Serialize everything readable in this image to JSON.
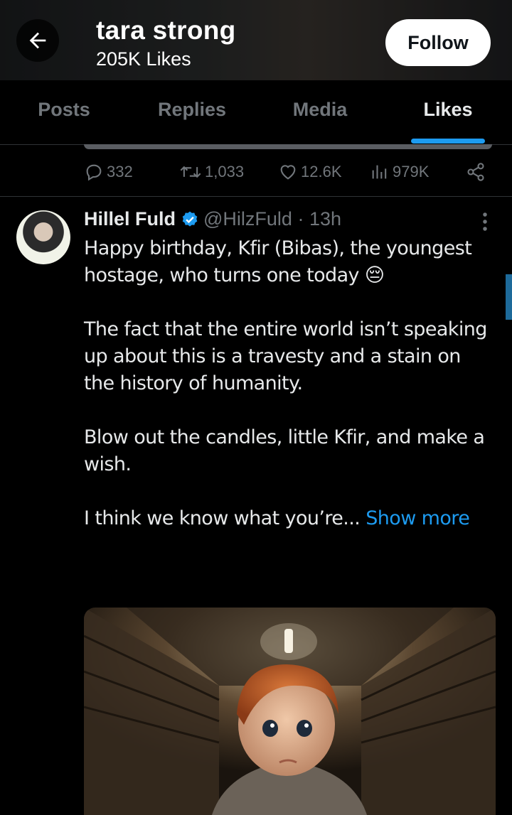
{
  "header": {
    "title": "tara strong",
    "subtitle": "205K Likes",
    "follow_label": "Follow"
  },
  "tabs": [
    {
      "label": "Posts",
      "active": false
    },
    {
      "label": "Replies",
      "active": false
    },
    {
      "label": "Media",
      "active": false
    },
    {
      "label": "Likes",
      "active": true
    }
  ],
  "prev_post_actions": {
    "replies": "332",
    "reposts": "1,033",
    "likes": "12.6K",
    "views": "979K",
    "icons": [
      "reply-icon",
      "repost-icon",
      "like-icon",
      "views-icon",
      "share-icon"
    ]
  },
  "tweet": {
    "author_name": "Hillel Fuld",
    "handle_time": "@HilzFuld · 13h",
    "verified": true,
    "paragraphs": [
      "Happy birthday, Kfir (Bibas), the youngest hostage, who turns one today 😔",
      "The fact that the entire world isn’t speaking up about this is a travesty and a stain on the history of humanity.",
      "Blow out the candles, little Kfir, and make a wish."
    ],
    "truncated_line": "I think we know what you’re...",
    "show_more": "Show more"
  },
  "colors": {
    "accent": "#1d9bf0",
    "muted": "#71767b",
    "text": "#e7e9ea",
    "background": "#000000"
  }
}
